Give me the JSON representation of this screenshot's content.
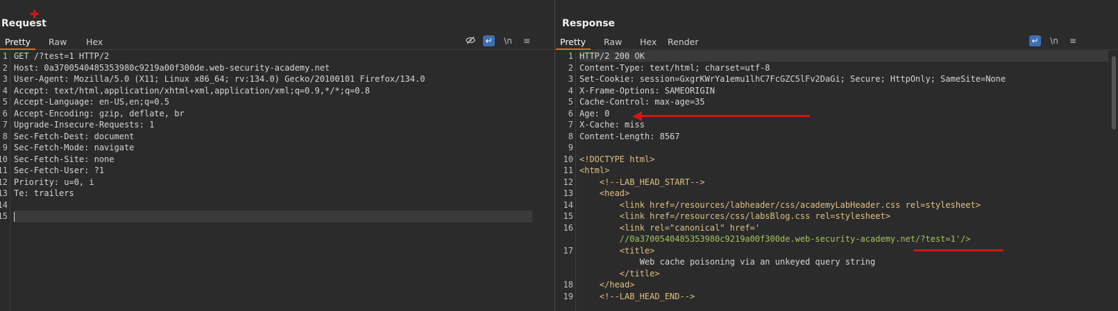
{
  "request": {
    "title": "Request",
    "tabs": [
      "Pretty",
      "Raw",
      "Hex"
    ],
    "toolbar": {
      "hide_icon": "eye-slash-icon",
      "wrap_label": "↵",
      "newline_label": "\\n",
      "menu_label": "≡"
    },
    "lines": [
      "GET /?test=1 HTTP/2",
      "Host: 0a3700540485353980c9219a00f300de.web-security-academy.net",
      "User-Agent: Mozilla/5.0 (X11; Linux x86_64; rv:134.0) Gecko/20100101 Firefox/134.0",
      "Accept: text/html,application/xhtml+xml,application/xml;q=0.9,*/*;q=0.8",
      "Accept-Language: en-US,en;q=0.5",
      "Accept-Encoding: gzip, deflate, br",
      "Upgrade-Insecure-Requests: 1",
      "Sec-Fetch-Dest: document",
      "Sec-Fetch-Mode: navigate",
      "Sec-Fetch-Site: none",
      "Sec-Fetch-User: ?1",
      "Priority: u=0, i",
      "Te: trailers",
      "",
      ""
    ]
  },
  "response": {
    "title": "Response",
    "tabs": [
      "Pretty",
      "Raw",
      "Hex",
      "Render"
    ],
    "toolbar": {
      "wrap_label": "↵",
      "newline_label": "\\n",
      "menu_label": "≡"
    },
    "line_numbers": [
      "1",
      "2",
      "3",
      "4",
      "5",
      "6",
      "7",
      "8",
      "9",
      "10",
      "11",
      "12",
      "13",
      "14",
      "15",
      "16",
      "",
      "17",
      "",
      "",
      "18",
      "19"
    ],
    "lines": [
      "HTTP/2 200 OK",
      "Content-Type: text/html; charset=utf-8",
      "Set-Cookie: session=GxgrKWrYa1emu1lhC7FcGZC5lFv2DaGi; Secure; HttpOnly; SameSite=None",
      "X-Frame-Options: SAMEORIGIN",
      "Cache-Control: max-age=35",
      "Age: 0",
      "X-Cache: miss",
      "Content-Length: 8567",
      "",
      "<!DOCTYPE html>",
      "<html>",
      "    <!--LAB_HEAD_START-->",
      "    <head>",
      "        <link href=/resources/labheader/css/academyLabHeader.css rel=stylesheet>",
      "        <link href=/resources/css/labsBlog.css rel=stylesheet>",
      "        <link rel=\"canonical\" href='",
      "        //0a3700540485353980c9219a00f300de.web-security-academy.net/?test=1'/>",
      "        <title>",
      "            Web cache poisoning via an unkeyed query string",
      "        </title>",
      "    </head>",
      "    <!--LAB_HEAD_END-->"
    ]
  },
  "colors": {
    "accent": "#e86c24",
    "annotation": "#d61414",
    "toggle": "#3d6fb3"
  }
}
